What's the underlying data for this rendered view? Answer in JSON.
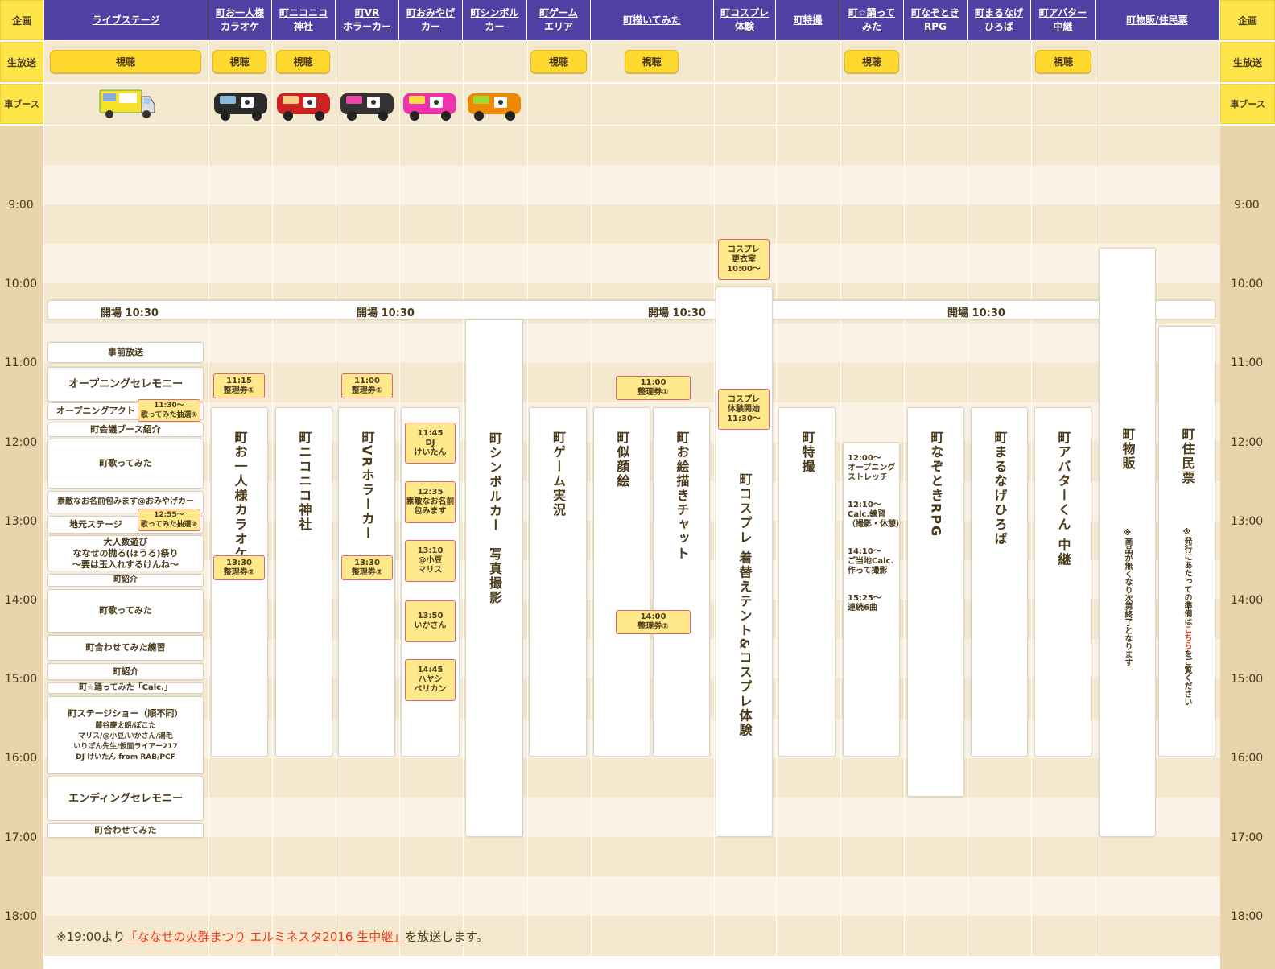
{
  "side": {
    "kikaku": "企画",
    "live": "生放送",
    "booth": "車ブース"
  },
  "headers": [
    "ライブステージ",
    "町お一人様\nカラオケ",
    "町ニコニコ\n神社",
    "町VR\nホラーカー",
    "町おみやげ\nカー",
    "町シンボル\nカー",
    "町ゲーム\nエリア",
    "町描いてみた",
    "町コスプレ\n体験",
    "町特撮",
    "町☆踊って\nみた",
    "町なぞとき\nRPG",
    "町まるなげ\nひろば",
    "町アバター\n中継",
    "町物販/住民票"
  ],
  "watch_label": "視聴",
  "times": [
    "9:00",
    "10:00",
    "11:00",
    "12:00",
    "13:00",
    "14:00",
    "15:00",
    "16:00",
    "17:00",
    "18:00"
  ],
  "opening": "開場 10:30",
  "stage": {
    "pre": "事前放送",
    "opening_cer": "オープニングセレモニー",
    "opening_act": "オープニングアクト",
    "ticket1": "11:30～\n歌ってみた抽選①",
    "booth_intro": "町会議ブース紹介",
    "utatte1": "町歌ってみた",
    "namae": "素敵なお名前包みます@おみやげカー",
    "jimoto": "地元ステージ",
    "ticket2": "12:55～\n歌ってみた抽選②",
    "otona": "大人数遊び\nななせの抛る(ほうる)祭り\n～要は玉入れするけんね～",
    "intro1": "町紹介",
    "utatte2": "町歌ってみた",
    "awase_practice": "町合わせてみた練習",
    "intro2": "町紹介",
    "odotte": "町☆踊ってみた「Calc.」",
    "show_title": "町ステージショー（順不同）",
    "show_cast": "藤谷慶太朗/ぽこた\nマリス/@小豆/いかさん/湯毛\nいりぽん先生/仮面ライアー217\nDJ けいたん from RAB/PCF",
    "ending": "エンディングセレモニー",
    "awase": "町合わせてみた"
  },
  "karaoke": {
    "title": "町お一人様カラオケ",
    "t1": "11:15\n整理券①",
    "t2": "13:30\n整理券②"
  },
  "jinja": {
    "title": "町ニコニコ神社"
  },
  "vr": {
    "title": "町VRホラーカー",
    "t1": "11:00\n整理券①",
    "t2": "13:30\n整理券②"
  },
  "omiyage": [
    "11:45\nDJ\nけいたん",
    "12:35\n素敵なお名前\n包みます",
    "13:10\n@小豆\nマリス",
    "13:50\nいかさん",
    "14:45\nハヤシ\nペリカン"
  ],
  "symbol": {
    "title": "町シンボルカー　写真撮影"
  },
  "game": {
    "title": "町ゲーム実況"
  },
  "draw": {
    "nigao": "町似顔絵",
    "oekaki": "町お絵描きチャット",
    "t1": "11:00\n整理券①",
    "t2": "14:00\n整理券②"
  },
  "cosplay": {
    "room": "コスプレ\n更衣室\n10:00～",
    "start": "コスプレ\n体験開始\n11:30～",
    "title": "町コスプレ 着替えテント&コスプレ体験"
  },
  "tokusatsu": {
    "title": "町特撮"
  },
  "dance": {
    "items": [
      "12:00～\nオープニング\nストレッチ",
      "12:10～\nCalc.練習\n（撮影・休憩）",
      "14:10～\nご当地Calc.\n作って撮影",
      "15:25～\n連続6曲"
    ]
  },
  "nazotoki": {
    "title": "町なぞときRPG"
  },
  "marunage": {
    "title": "町まるなげひろば"
  },
  "avatar": {
    "title": "町アバターくん 中継"
  },
  "buppan": {
    "title": "町物販",
    "note": "※商品が無くなり次第終了となります"
  },
  "jumin": {
    "title": "町住民票",
    "note_a": "※発行にあたっての準備は",
    "note_link": "こちら",
    "note_b": "をご覧ください"
  },
  "footer": {
    "pre": "※19:00より",
    "link": "「ななせの火群まつり エルミネスタ2016 生中継」",
    "post": "を放送します。"
  },
  "colors": {
    "header": "#5040a4",
    "yellow": "#fde54a",
    "button": "#ffd92e",
    "link": "#e8401c"
  }
}
